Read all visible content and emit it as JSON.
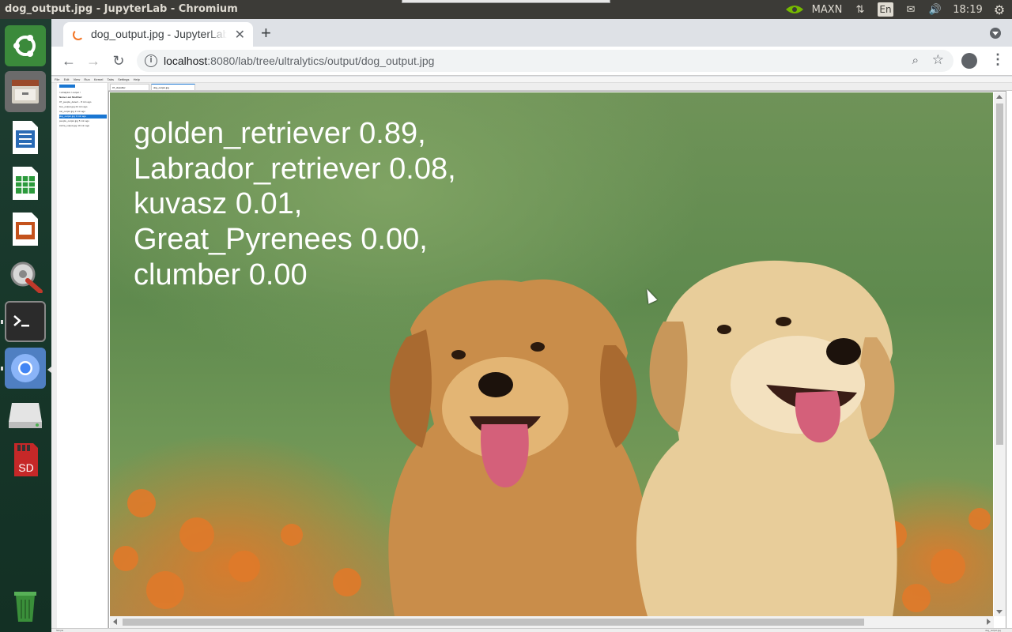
{
  "window": {
    "title": "dog_output.jpg - JupyterLab - Chromium"
  },
  "panel": {
    "nvidia_mode": "MAXN",
    "keyboard": "En",
    "clock": "18:19"
  },
  "launcher": {
    "items": [
      "ubuntu-dash",
      "files",
      "libreoffice-writer",
      "libreoffice-calc",
      "libreoffice-impress",
      "system-settings",
      "terminal",
      "chromium",
      "disk-drive",
      "sd-card",
      "trash"
    ]
  },
  "browser": {
    "tab_title": "dog_output.jpg - JupyterLab",
    "url_host": "localhost",
    "url_rest": ":8080/lab/tree/ultralytics/output/dog_output.jpg"
  },
  "jupyter": {
    "menu": [
      "File",
      "Edit",
      "View",
      "Run",
      "Kernel",
      "Tabs",
      "Settings",
      "Help"
    ],
    "path": "/ ultralytics / output /",
    "columns": [
      "Name",
      "Last Modified"
    ],
    "files": [
      {
        "name": "07_people_detect...",
        "modified": "8 min ago"
      },
      {
        "name": "bus_output.jpg",
        "modified": "24 min ago"
      },
      {
        "name": "cat_output.jpg",
        "modified": "2 min ago"
      },
      {
        "name": "dog_output.jpg",
        "modified": "3 min ago"
      },
      {
        "name": "people_output.jpg",
        "modified": "5 min ago"
      },
      {
        "name": "zebra_output.jpg",
        "modified": "10 min ago"
      }
    ],
    "doc_tabs": [
      "07_classifier",
      "dog_output.jpg"
    ],
    "status_left": "Simple",
    "status_right": "dog_output.jpg"
  },
  "image": {
    "predictions": [
      "golden_retriever 0.89,",
      "Labrador_retriever 0.08,",
      "kuvasz 0.01,",
      "Great_Pyrenees 0.00,",
      "clumber 0.00"
    ],
    "description": "two golden retriever puppies"
  }
}
